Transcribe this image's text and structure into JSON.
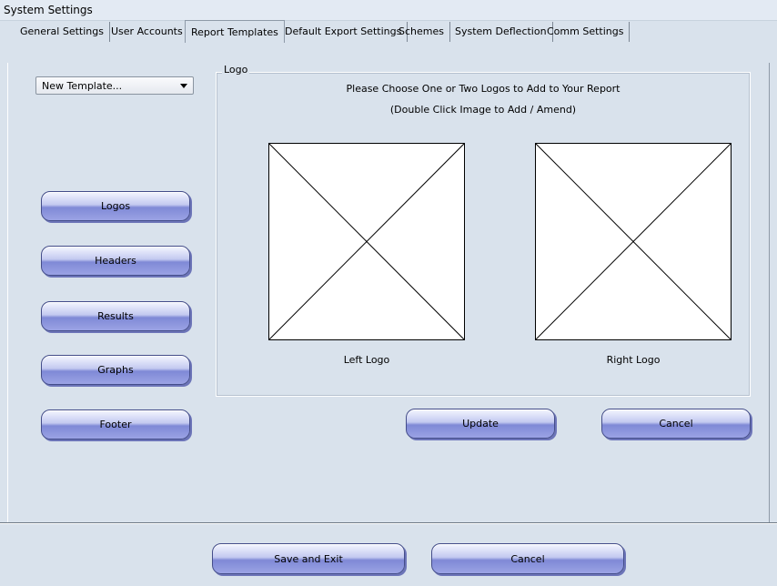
{
  "window": {
    "title": "System Settings"
  },
  "tabs": [
    {
      "label": "General Settings"
    },
    {
      "label": "User Accounts"
    },
    {
      "label": "Report Templates",
      "active": true
    },
    {
      "label": "Default Export Settings"
    },
    {
      "label": "Schemes"
    },
    {
      "label": "System Deflection"
    },
    {
      "label": "Comm Settings"
    }
  ],
  "template_select": {
    "value": "New Template..."
  },
  "sections": {
    "logos": "Logos",
    "headers": "Headers",
    "results": "Results",
    "graphs": "Graphs",
    "footer": "Footer"
  },
  "logo_group": {
    "label": "Logo",
    "instruction": "Please Choose One or Two Logos to Add to Your Report",
    "hint": "(Double Click Image to Add / Amend)",
    "left_caption": "Left Logo",
    "right_caption": "Right Logo",
    "update_label": "Update",
    "cancel_label": "Cancel"
  },
  "footer": {
    "save_label": "Save and Exit",
    "cancel_label": "Cancel"
  },
  "colors": {
    "button_fill": "#8a93df",
    "button_border": "#444d8a",
    "panel_bg": "#d9e2ec"
  },
  "icons": [
    "placeholder-image-icon",
    "dropdown-caret-icon"
  ]
}
